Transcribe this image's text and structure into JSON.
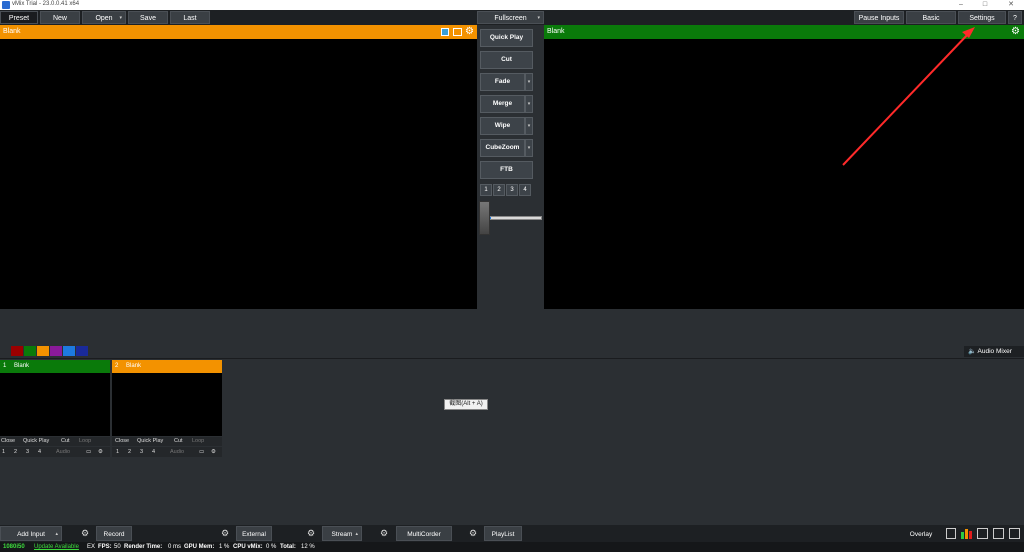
{
  "window": {
    "title": "vMix Trial - 23.0.0.41 x64"
  },
  "toolbar": {
    "preset": "Preset",
    "new": "New",
    "open": "Open",
    "save": "Save",
    "last": "Last",
    "fullscreen": "Fullscreen",
    "pause_inputs": "Pause Inputs",
    "basic": "Basic",
    "settings": "Settings",
    "help": "?"
  },
  "preview": {
    "label": "Blank"
  },
  "program": {
    "label": "Blank"
  },
  "transitions": {
    "quick_play": "Quick Play",
    "cut": "Cut",
    "fade": "Fade",
    "merge": "Merge",
    "wipe": "Wipe",
    "cubezoom": "CubeZoom",
    "ftb": "FTB",
    "numbers": [
      "1",
      "2",
      "3",
      "4"
    ]
  },
  "colors": {
    "preview": "#f39200",
    "program": "#0a7a0a",
    "swatches": [
      "#9b0000",
      "#0a7a0a",
      "#f39200",
      "#8a1a9a",
      "#1d7ae0",
      "#1a2a9a"
    ]
  },
  "audio_mixer": {
    "label": "Audio Mixer"
  },
  "inputs": [
    {
      "number": "1",
      "name": "Blank",
      "state": "program",
      "controls": [
        "Close",
        "Quick Play",
        "Cut",
        "Loop"
      ],
      "nums": [
        "1",
        "2",
        "3",
        "4"
      ],
      "audio": "Audio"
    },
    {
      "number": "2",
      "name": "Blank",
      "state": "preview",
      "controls": [
        "Close",
        "Quick Play",
        "Cut",
        "Loop"
      ],
      "nums": [
        "1",
        "2",
        "3",
        "4"
      ],
      "audio": "Audio"
    }
  ],
  "tooltip": {
    "text": "截图(Alt + A)"
  },
  "bottom": {
    "add_input": "Add Input",
    "record": "Record",
    "external": "External",
    "stream": "Stream",
    "multicorder": "MultiCorder",
    "playlist": "PlayList",
    "overlay": "Overlay"
  },
  "status": {
    "resolution": "1080i50",
    "update": "Update Available",
    "ex": "EX",
    "fps_label": "FPS:",
    "fps": "50",
    "render_label": "Render Time:",
    "render": "0 ms",
    "gpu_label": "GPU Mem:",
    "gpu": "1 %",
    "cpu_label": "CPU vMix:",
    "cpu": "0 %",
    "total_label": "Total:",
    "total": "12 %"
  }
}
